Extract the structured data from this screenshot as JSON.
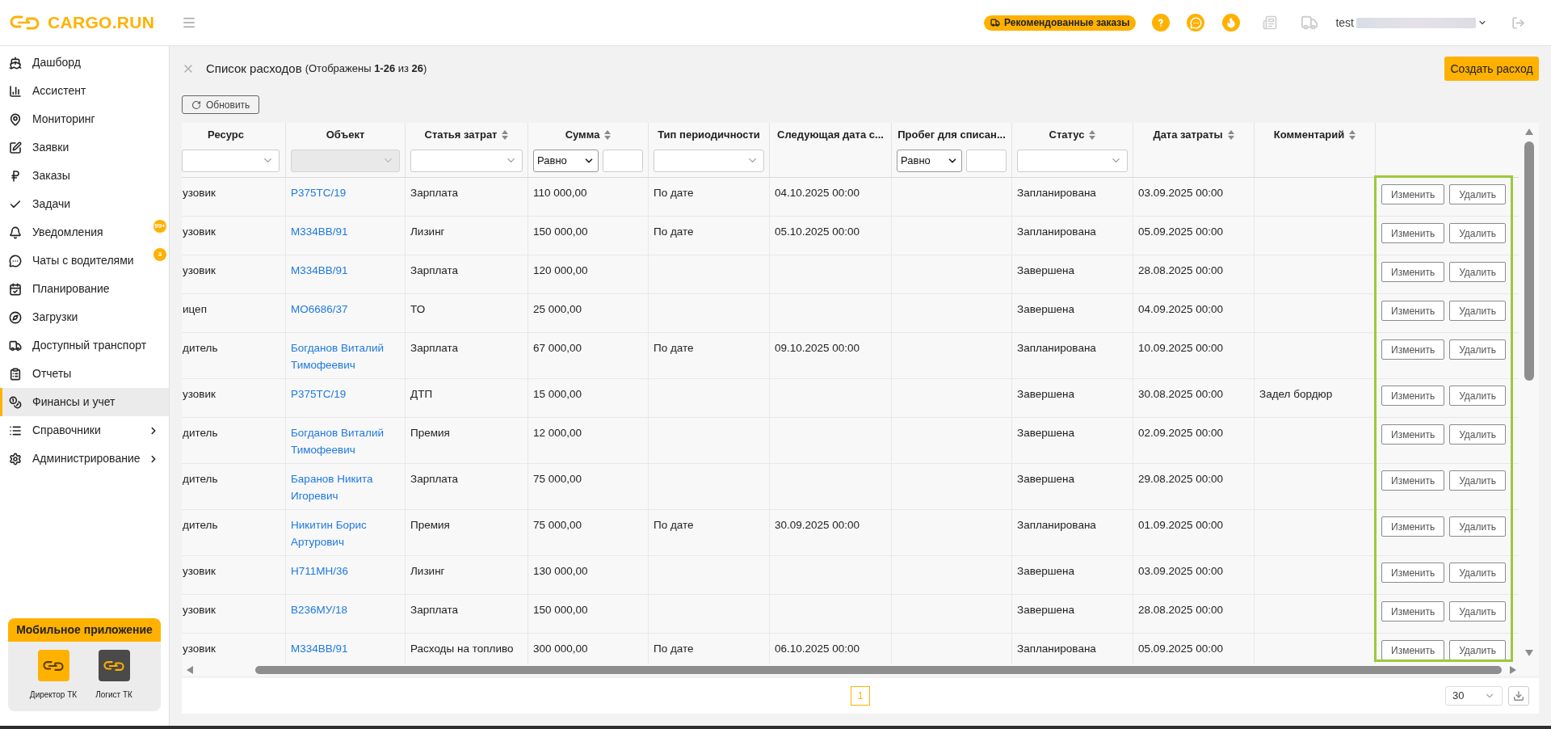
{
  "topbar": {
    "logo": "CARGO.RUN",
    "recommended_button": "Рекомендованные заказы",
    "user": "test"
  },
  "sidebar": {
    "items": [
      {
        "label": "Дашборд",
        "selected": false,
        "expandable": false
      },
      {
        "label": "Ассистент",
        "selected": false,
        "expandable": false
      },
      {
        "label": "Мониторинг",
        "selected": false,
        "expandable": false
      },
      {
        "label": "Заявки",
        "selected": false,
        "expandable": false
      },
      {
        "label": "Заказы",
        "selected": false,
        "expandable": false
      },
      {
        "label": "Задачи",
        "selected": false,
        "expandable": false
      },
      {
        "label": "Уведомления",
        "selected": false,
        "expandable": false,
        "badge": "99+"
      },
      {
        "label": "Чаты с водителями",
        "selected": false,
        "expandable": false,
        "badge": "3"
      },
      {
        "label": "Планирование",
        "selected": false,
        "expandable": false
      },
      {
        "label": "Загрузки",
        "selected": false,
        "expandable": false
      },
      {
        "label": "Доступный транспорт",
        "selected": false,
        "expandable": false
      },
      {
        "label": "Отчеты",
        "selected": false,
        "expandable": false
      },
      {
        "label": "Финансы и учет",
        "selected": true,
        "expandable": false
      },
      {
        "label": "Справочники",
        "selected": false,
        "expandable": true
      },
      {
        "label": "Администрирование",
        "selected": false,
        "expandable": true
      }
    ],
    "mobile_app": {
      "title": "Мобильное приложение",
      "apps": [
        {
          "label": "Директор ТК",
          "color": "#ffb100"
        },
        {
          "label": "Логист ТК",
          "color": "#4a4a4a"
        }
      ]
    }
  },
  "page": {
    "title": "Список расходов",
    "summary": "(Отображены **1-26** из **26**)",
    "create_button": "Создать расход",
    "refresh_button": "Обновить"
  },
  "table": {
    "columns": [
      {
        "label": "Ресурс",
        "sortable": false,
        "filter": {
          "kind": "select",
          "disabled": false
        }
      },
      {
        "label": "Объект",
        "sortable": false,
        "filter": {
          "kind": "select",
          "disabled": true
        }
      },
      {
        "label": "Статья затрат",
        "sortable": true,
        "filter": {
          "kind": "select",
          "disabled": false
        }
      },
      {
        "label": "Сумма",
        "sortable": true,
        "filter": {
          "kind": "compare",
          "operator": "Равно"
        }
      },
      {
        "label": "Тип периодичности",
        "sortable": false,
        "filter": {
          "kind": "select",
          "disabled": false
        }
      },
      {
        "label": "Следующая дата с...",
        "sortable": false
      },
      {
        "label": "Пробег для списан...",
        "sortable": false,
        "filter": {
          "kind": "compare",
          "operator": "Равно"
        }
      },
      {
        "label": "Статус",
        "sortable": true,
        "filter": {
          "kind": "select",
          "disabled": false
        }
      },
      {
        "label": "Дата затраты",
        "sortable": true
      },
      {
        "label": "Комментарий",
        "sortable": true
      }
    ],
    "rows": [
      {
        "resource": "узовик",
        "object": "Р375ТС/19",
        "cost_item": "Зарплата",
        "amount": "110 000,00",
        "periodicity": "По дате",
        "next_date": "04.10.2025 00:00",
        "status": "Запланирована",
        "date": "03.09.2025 00:00",
        "actions": [
          "Изменить",
          "Удалить"
        ]
      },
      {
        "resource": "узовик",
        "object": "М334ВВ/91",
        "cost_item": "Лизинг",
        "amount": "150 000,00",
        "periodicity": "По дате",
        "next_date": "05.10.2025 00:00",
        "status": "Запланирована",
        "date": "05.09.2025 00:00",
        "actions": [
          "Изменить",
          "Удалить"
        ]
      },
      {
        "resource": "узовик",
        "object": "М334ВВ/91",
        "cost_item": "Зарплата",
        "amount": "120 000,00",
        "status": "Завершена",
        "date": "28.08.2025 00:00",
        "actions": [
          "Изменить",
          "Удалить"
        ]
      },
      {
        "resource": "ицеп",
        "object": "МО6686/37",
        "cost_item": "ТО",
        "amount": "25 000,00",
        "status": "Завершена",
        "date": "04.09.2025 00:00",
        "actions": [
          "Изменить",
          "Удалить"
        ]
      },
      {
        "resource": "дитель",
        "object": "Богданов Виталий Тимофеевич",
        "cost_item": "Зарплата",
        "amount": "67 000,00",
        "periodicity": "По дате",
        "next_date": "09.10.2025 00:00",
        "status": "Запланирована",
        "date": "10.09.2025 00:00",
        "actions": [
          "Изменить",
          "Удалить"
        ]
      },
      {
        "resource": "узовик",
        "object": "Р375ТС/19",
        "cost_item": "ДТП",
        "amount": "15 000,00",
        "status": "Завершена",
        "date": "30.08.2025 00:00",
        "comment": "Задел бордюр",
        "actions": [
          "Изменить",
          "Удалить"
        ]
      },
      {
        "resource": "дитель",
        "object": "Богданов Виталий Тимофеевич",
        "cost_item": "Премия",
        "amount": "12 000,00",
        "status": "Завершена",
        "date": "02.09.2025 00:00",
        "actions": [
          "Изменить",
          "Удалить"
        ]
      },
      {
        "resource": "дитель",
        "object": "Баранов Никита Игоревич",
        "cost_item": "Зарплата",
        "amount": "75 000,00",
        "status": "Завершена",
        "date": "29.08.2025 00:00",
        "actions": [
          "Изменить",
          "Удалить"
        ]
      },
      {
        "resource": "дитель",
        "object": "Никитин Борис Артурович",
        "cost_item": "Премия",
        "amount": "75 000,00",
        "periodicity": "По дате",
        "next_date": "30.09.2025 00:00",
        "status": "Запланирована",
        "date": "01.09.2025 00:00",
        "actions": [
          "Изменить",
          "Удалить"
        ]
      },
      {
        "resource": "узовик",
        "object": "Н711МН/36",
        "cost_item": "Лизинг",
        "amount": "130 000,00",
        "status": "Завершена",
        "date": "03.09.2025 00:00",
        "actions": [
          "Изменить",
          "Удалить"
        ]
      },
      {
        "resource": "узовик",
        "object": "В236МУ/18",
        "cost_item": "Зарплата",
        "amount": "150 000,00",
        "status": "Завершена",
        "date": "28.08.2025 00:00",
        "actions": [
          "Изменить",
          "Удалить"
        ]
      },
      {
        "resource": "узовик",
        "object": "М334ВВ/91",
        "cost_item": "Расходы на топливо",
        "amount": "300 000,00",
        "periodicity": "По дате",
        "next_date": "06.10.2025 00:00",
        "status": "Запланирована",
        "date": "05.09.2025 00:00",
        "actions": [
          "Изменить",
          "Удалить"
        ]
      }
    ]
  },
  "pagination": {
    "pages": [
      {
        "label": "1",
        "selected": true
      }
    ],
    "page_size": "30"
  }
}
